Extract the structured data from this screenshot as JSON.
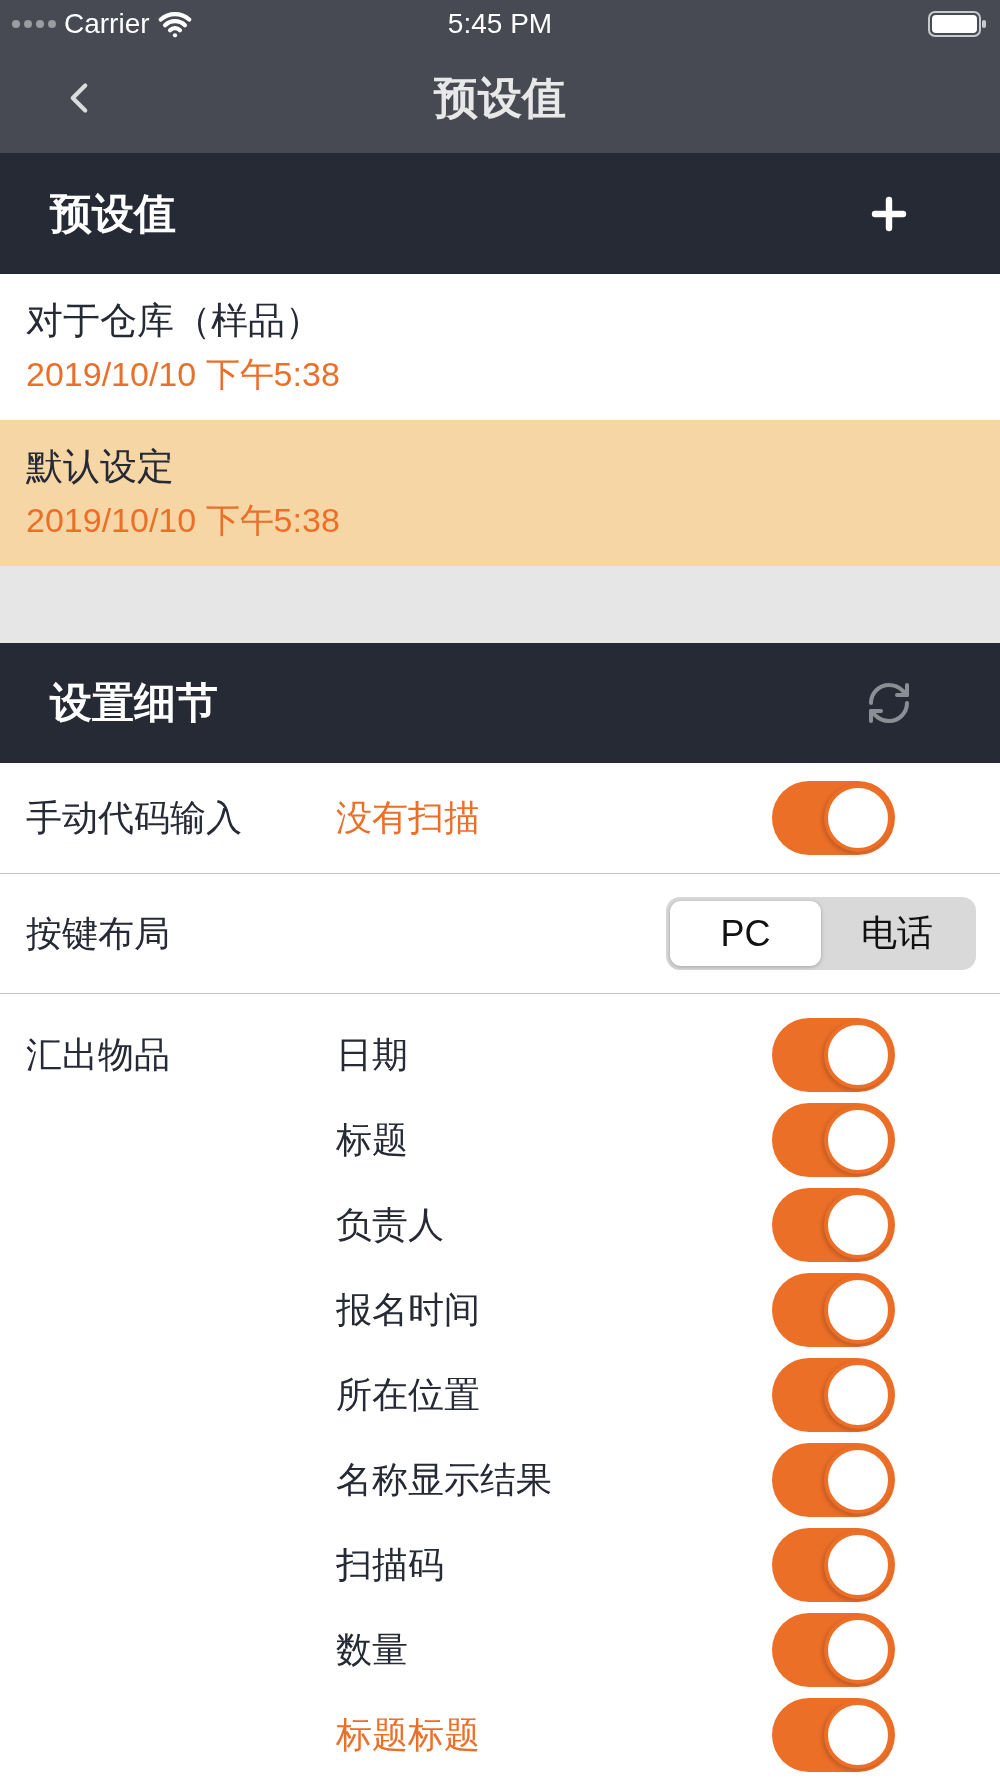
{
  "status_bar": {
    "carrier": "Carrier",
    "time": "5:45 PM"
  },
  "nav_bar": {
    "title": "预设值"
  },
  "presets": {
    "title": "预设值",
    "items": [
      {
        "name": "对于仓库（样品）",
        "date": "2019/10/10 下午5:38",
        "selected": false
      },
      {
        "name": "默认设定",
        "date": "2019/10/10 下午5:38",
        "selected": true
      }
    ]
  },
  "details": {
    "title": "设置细节",
    "manual_input": {
      "label": "手动代码输入",
      "value": "没有扫描",
      "on": true
    },
    "key_layout": {
      "label": "按键布局",
      "options": [
        {
          "label": "PC",
          "selected": true
        },
        {
          "label": "电话",
          "selected": false
        }
      ]
    },
    "export_items": {
      "label": "汇出物品",
      "items": [
        {
          "label": "日期",
          "kind": "field",
          "on": true
        },
        {
          "label": "标题",
          "kind": "field",
          "on": true
        },
        {
          "label": "负责人",
          "kind": "field",
          "on": true
        },
        {
          "label": "报名时间",
          "kind": "field",
          "on": true
        },
        {
          "label": "所在位置",
          "kind": "field",
          "on": true
        },
        {
          "label": "名称显示结果",
          "kind": "field",
          "on": true
        },
        {
          "label": "扫描码",
          "kind": "field",
          "on": true
        },
        {
          "label": "数量",
          "kind": "field",
          "on": true
        },
        {
          "label": "标题标题",
          "kind": "custom",
          "on": true
        }
      ]
    }
  }
}
